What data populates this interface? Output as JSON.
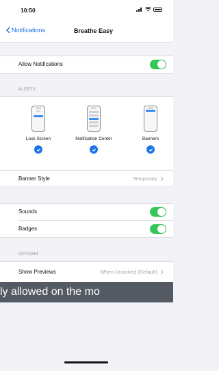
{
  "status_bar": {
    "time": "10:50"
  },
  "nav": {
    "back_label": "Notifications",
    "title": "Breathe Easy"
  },
  "allow_notifications": {
    "label": "Allow Notifications",
    "enabled": true
  },
  "alerts": {
    "header": "ALERTS",
    "styles": [
      {
        "label": "Lock Screen",
        "checked": true,
        "clock": "9:41"
      },
      {
        "label": "Notification Center",
        "checked": true
      },
      {
        "label": "Banners",
        "checked": true
      }
    ],
    "banner_style": {
      "label": "Banner Style",
      "value": "Temporary"
    }
  },
  "sounds": {
    "label": "Sounds",
    "enabled": true
  },
  "badges": {
    "label": "Badges",
    "enabled": true
  },
  "options": {
    "header": "OPTIONS",
    "show_previews": {
      "label": "Show Previews",
      "value": "When Unlocked (Default)"
    }
  },
  "overlay_banner": {
    "text": "ly allowed on the mo"
  },
  "colors": {
    "accent": "#1a73e8",
    "toggle_on": "#34c759",
    "banner_bg": "#545a63"
  }
}
